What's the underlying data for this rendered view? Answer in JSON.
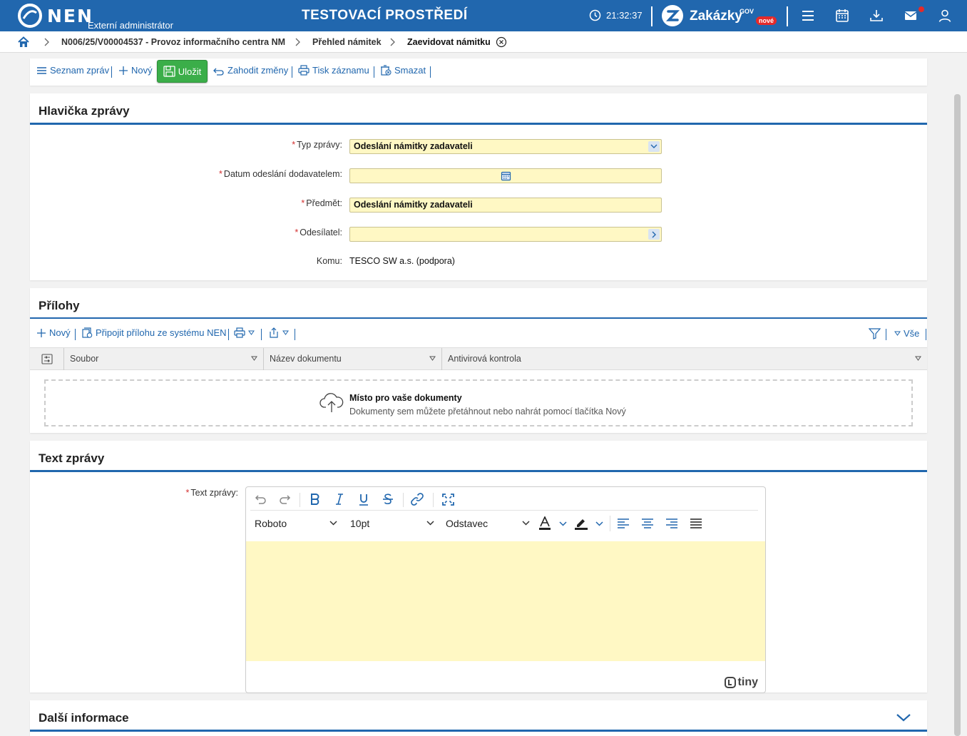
{
  "topbar": {
    "brand": "NEN",
    "subtitle": "Externí administrátor",
    "environment": "TESTOVACÍ PROSTŘEDÍ",
    "time": "21:32:37",
    "zakazky": "Zakázky",
    "gov": "GOV",
    "badge": "nové",
    "color": "#2167ae"
  },
  "breadcrumb": {
    "items": [
      "N006/25/V00004537 - Provoz informačního centra NM",
      "Přehled námitek",
      "Zaevidovat námitku"
    ]
  },
  "toolbar": {
    "list_label": "Seznam zpráv",
    "new_label": "Nový",
    "save_label": "Uložit",
    "discard_label": "Zahodit změny",
    "print_label": "Tisk záznamu",
    "delete_label": "Smazat"
  },
  "header_section": {
    "title": "Hlavička zprávy",
    "fields": {
      "type": {
        "label": "Typ zprávy:",
        "value": "Odeslání námitky zadavateli"
      },
      "date": {
        "label": "Datum odeslání dodavatelem:",
        "value": ""
      },
      "subject": {
        "label": "Předmět:",
        "value": "Odeslání námitky zadavateli"
      },
      "sender": {
        "label": "Odesílatel:",
        "value": ""
      },
      "to": {
        "label": "Komu:",
        "value": "TESCO SW a.s. (podpora)"
      }
    }
  },
  "attachments": {
    "title": "Přílohy",
    "new_label": "Nový",
    "attach_label": "Připojit přílohu ze systému NEN",
    "all_label": "Vše",
    "columns": [
      "Soubor",
      "Název dokumentu",
      "Antivirová kontrola"
    ],
    "drop_title": "Místo pro vaše dokumenty",
    "drop_text": "Dokumenty sem můžete přetáhnout nebo nahrát pomocí tlačítka Nový"
  },
  "message_text": {
    "title": "Text zprávy",
    "label": "Text zprávy:",
    "font": "Roboto",
    "size": "10pt",
    "block": "Odstavec",
    "brand": "tiny"
  },
  "more_info": {
    "title": "Další informace"
  },
  "required_mark": "*"
}
